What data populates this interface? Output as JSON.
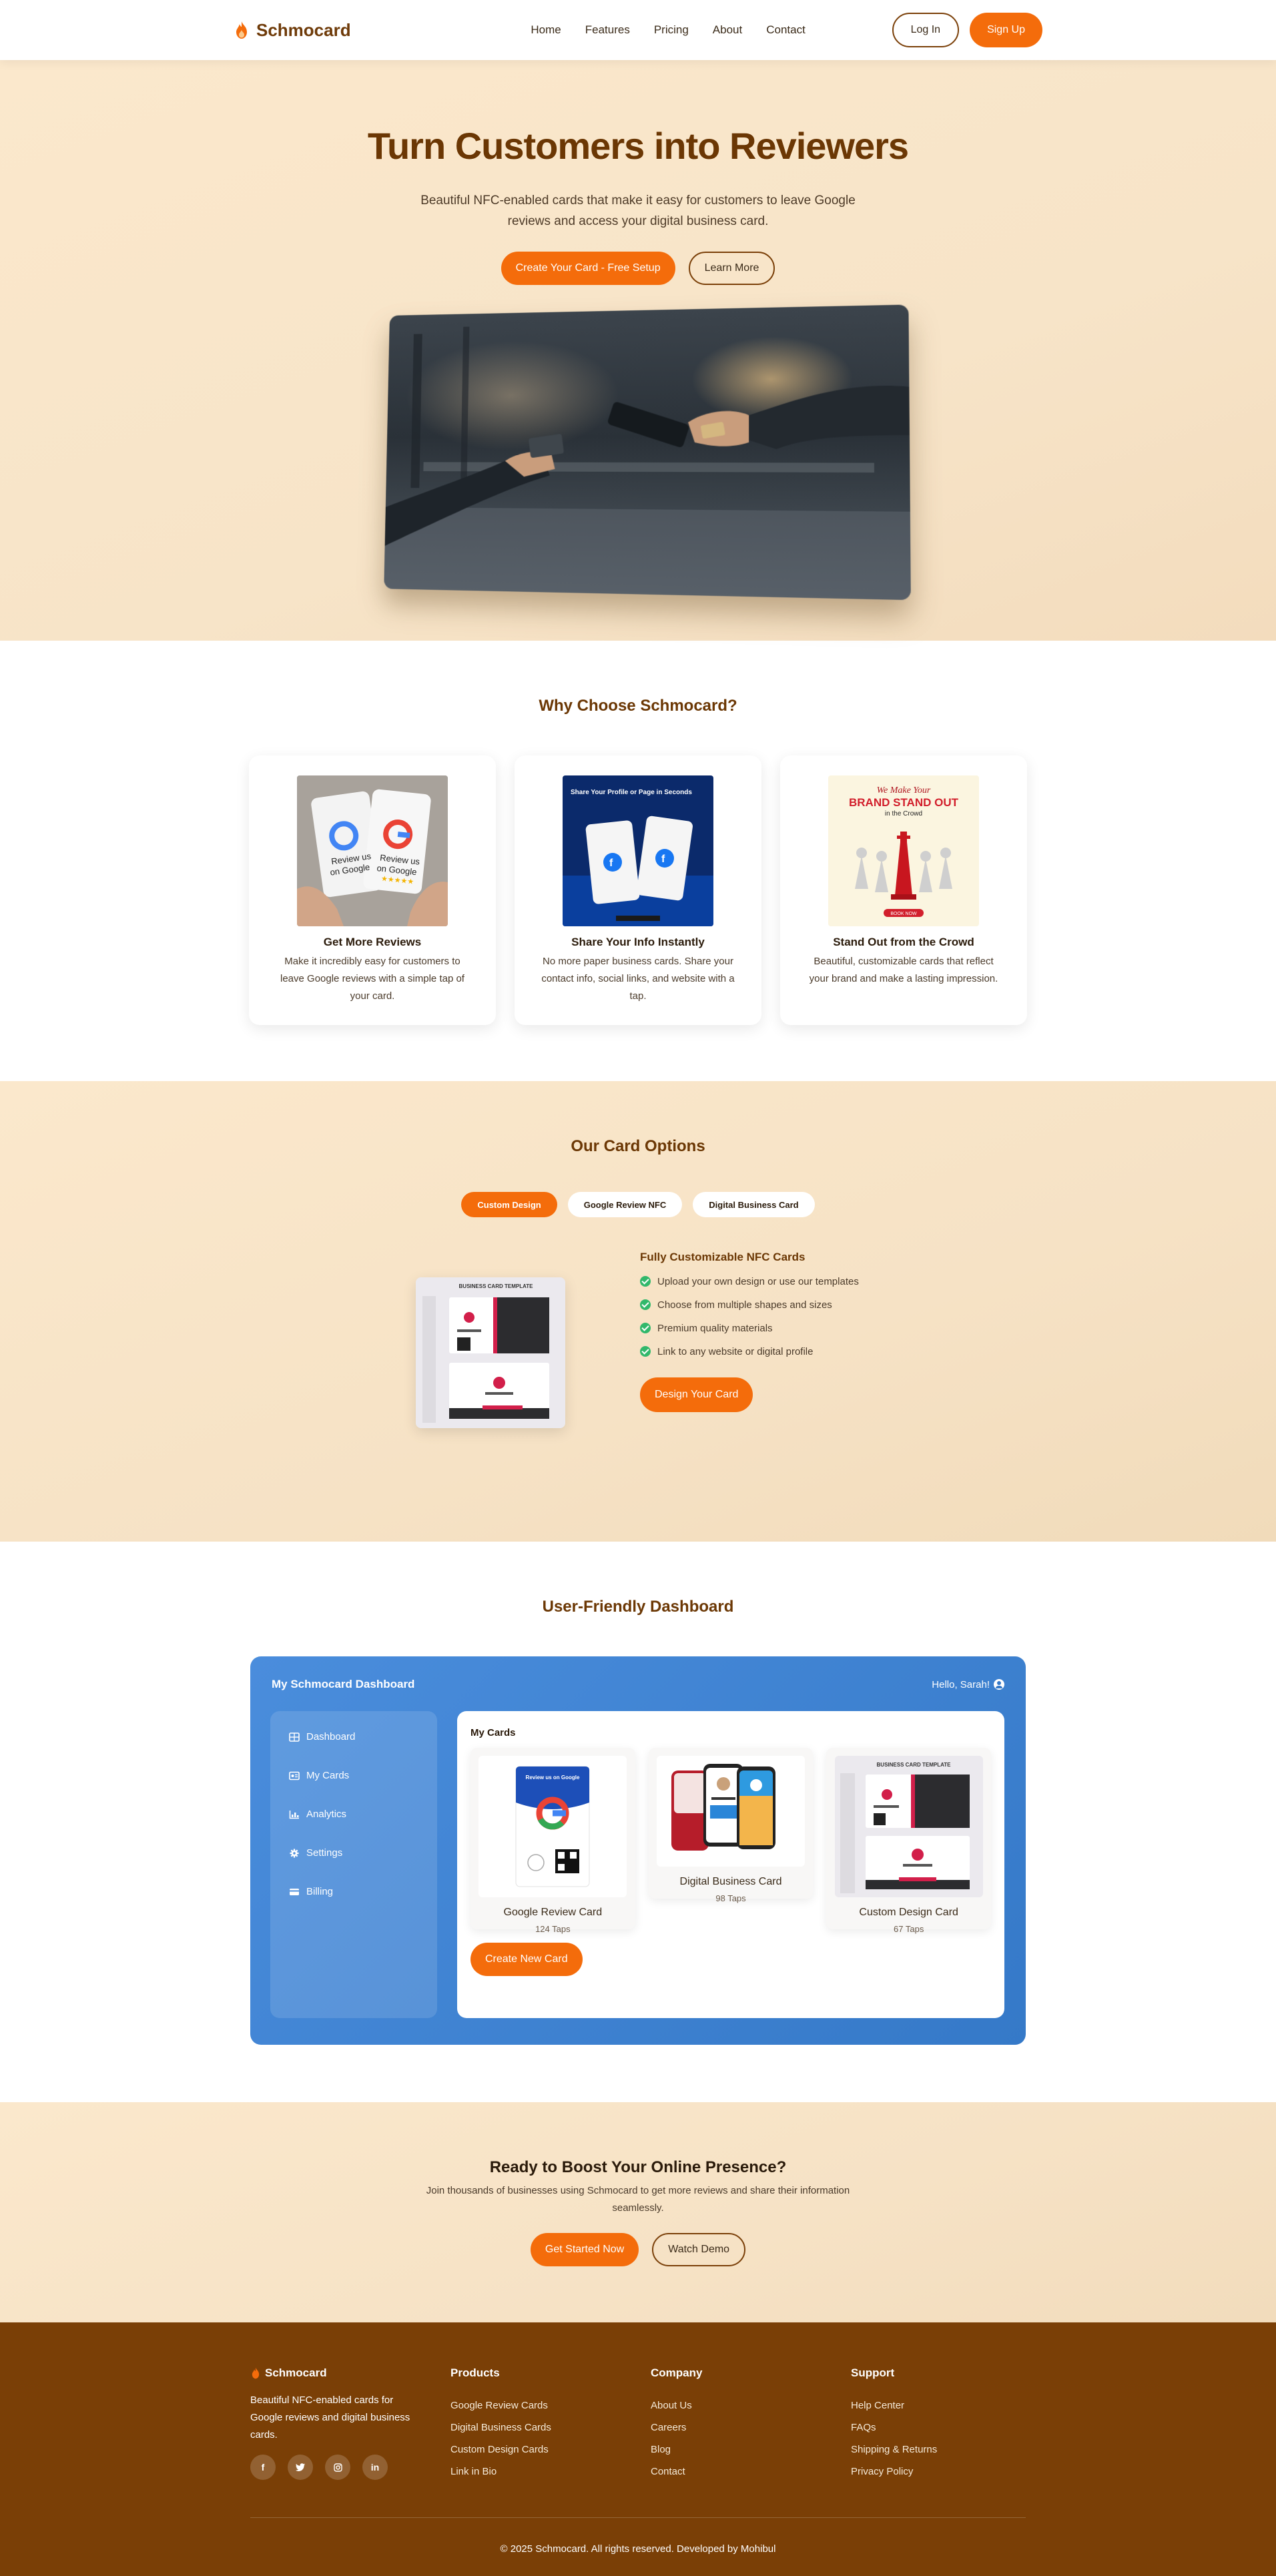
{
  "brand": {
    "name": "Schmocard",
    "accent": "#f46c0b",
    "brown": "#6b3704"
  },
  "nav": {
    "links": [
      "Home",
      "Features",
      "Pricing",
      "About",
      "Contact"
    ],
    "login": "Log In",
    "signup": "Sign Up"
  },
  "hero": {
    "title": "Turn Customers into Reviewers",
    "subtitle": "Beautiful NFC-enabled cards that make it easy for customers to leave Google reviews and access your digital business card.",
    "primary_button": "Create Your Card - Free Setup",
    "secondary_button": "Learn More"
  },
  "why": {
    "title": "Why Choose Schmocard?",
    "features": [
      {
        "title": "Get More Reviews",
        "text": "Make it incredibly easy for customers to leave Google reviews with a simple tap of your card.",
        "image_text": [
          "Review us",
          "on Google"
        ]
      },
      {
        "title": "Share Your Info Instantly",
        "text": "No more paper business cards. Share your contact info, social links, and website with a tap.",
        "image_text": [
          "Share Your Profile or Page in Seconds"
        ]
      },
      {
        "title": "Stand Out from the Crowd",
        "text": "Beautiful, customizable cards that reflect your brand and make a lasting impression.",
        "image_text": [
          "We Make Your",
          "BRAND STAND OUT",
          "in the Crowd",
          "BOOK NOW"
        ]
      }
    ]
  },
  "options": {
    "title": "Our Card Options",
    "tabs": [
      "Custom Design",
      "Google Review NFC",
      "Digital Business Card"
    ],
    "active_tab": "Custom Design",
    "heading": "Fully Customizable NFC Cards",
    "items": [
      "Upload your own design or use our templates",
      "Choose from multiple shapes and sizes",
      "Premium quality materials",
      "Link to any website or digital profile"
    ],
    "button": "Design Your Card",
    "image_text": "BUSINESS CARD TEMPLATE"
  },
  "dashboard": {
    "section_title": "User-Friendly Dashboard",
    "title": "My Schmocard Dashboard",
    "greeting": "Hello, Sarah!",
    "sidebar": [
      {
        "label": "Dashboard",
        "icon": "grid-icon"
      },
      {
        "label": "My Cards",
        "icon": "id-card-icon"
      },
      {
        "label": "Analytics",
        "icon": "chart-icon"
      },
      {
        "label": "Settings",
        "icon": "gear-icon"
      },
      {
        "label": "Billing",
        "icon": "credit-card-icon"
      }
    ],
    "cards_title": "My Cards",
    "cards": [
      {
        "name": "Google Review Card",
        "taps": "124 Taps",
        "image_text": "Review us on Google"
      },
      {
        "name": "Digital Business Card",
        "taps": "98 Taps"
      },
      {
        "name": "Custom Design Card",
        "taps": "67 Taps",
        "image_text": "BUSINESS CARD TEMPLATE"
      }
    ],
    "create_button": "Create New Card",
    "colors": {
      "from": "#4a8ddc",
      "to": "#3579c8"
    }
  },
  "cta": {
    "title": "Ready to Boost Your Online Presence?",
    "subtitle": "Join thousands of businesses using Schmocard to get more reviews and share their information seamlessly.",
    "primary_button": "Get Started Now",
    "secondary_button": "Watch Demo"
  },
  "footer": {
    "brand": "Schmocard",
    "description": "Beautiful NFC-enabled cards for Google reviews and digital business cards.",
    "socials": [
      "facebook-icon",
      "twitter-icon",
      "instagram-icon",
      "linkedin-icon"
    ],
    "columns": [
      {
        "title": "Products",
        "links": [
          "Google Review Cards",
          "Digital Business Cards",
          "Custom Design Cards",
          "Link in Bio"
        ]
      },
      {
        "title": "Company",
        "links": [
          "About Us",
          "Careers",
          "Blog",
          "Contact"
        ]
      },
      {
        "title": "Support",
        "links": [
          "Help Center",
          "FAQs",
          "Shipping & Returns",
          "Privacy Policy"
        ]
      }
    ],
    "copyright": "© 2025 Schmocard. All rights reserved. Developed by Mohibul"
  }
}
